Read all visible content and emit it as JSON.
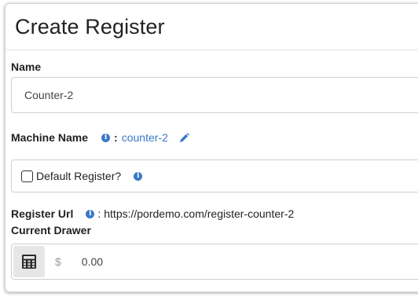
{
  "page": {
    "title": "Create Register"
  },
  "name_field": {
    "label": "Name",
    "value": "Counter-2"
  },
  "machine_name": {
    "label": "Machine Name",
    "separator": ":",
    "value": "counter-2"
  },
  "default_register": {
    "label": "Default Register?",
    "checked": false
  },
  "register_url": {
    "label": "Register Url",
    "separator": ":",
    "value": "https://pordemo.com/register-counter-2"
  },
  "current_drawer": {
    "label": "Current Drawer",
    "currency_symbol": "$",
    "value": "0.00"
  },
  "icons": {
    "info": "info-icon",
    "edit": "pencil-icon",
    "calculator": "calculator-icon"
  },
  "colors": {
    "accent": "#3a79c6",
    "border": "#cfcfcf",
    "calc_button_bg": "#e6e6e6"
  }
}
